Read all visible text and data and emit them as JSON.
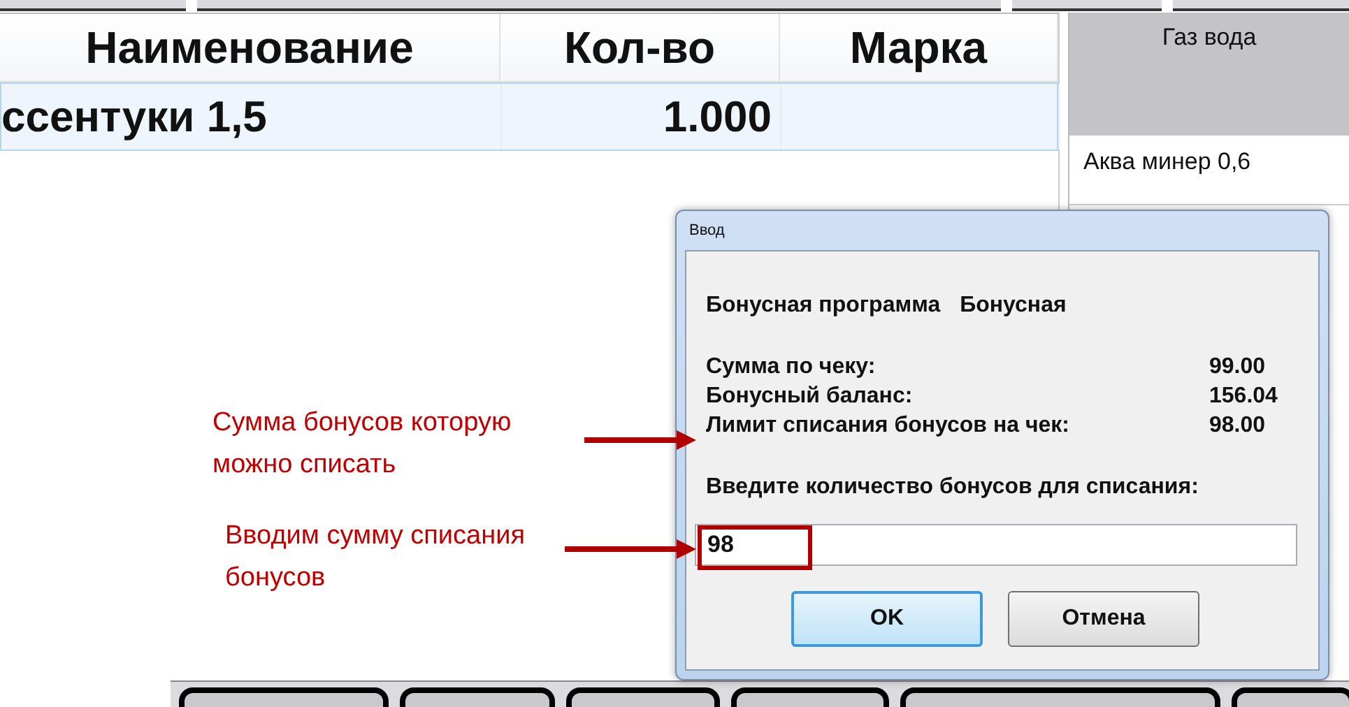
{
  "table": {
    "columns": [
      "Наименование",
      "Кол-во",
      "Марка"
    ],
    "rows": [
      {
        "name": "ссентуки 1,5",
        "qty": "1.000",
        "selected": true
      }
    ]
  },
  "right_panel": {
    "group": "Газ вода",
    "items": [
      "Аква минер 0,6"
    ]
  },
  "dialog": {
    "title": "Ввод",
    "program_label": "Бонусная программа",
    "program_value": "Бонусная",
    "summary": [
      {
        "label": "Сумма по чеку:",
        "value": "99.00"
      },
      {
        "label": "Бонусный баланс:",
        "value": "156.04"
      },
      {
        "label": "Лимит списания бонусов на чек:",
        "value": "98.00"
      }
    ],
    "prompt": "Введите количество бонусов для списания:",
    "input_value": "98",
    "buttons": [
      {
        "label": "OK",
        "default": true
      },
      {
        "label": "Отмена",
        "default": false
      }
    ]
  },
  "annotations": [
    {
      "text": "Сумма бонусов которую можно списать"
    },
    {
      "text": "Вводим сумму списания бонусов"
    }
  ]
}
